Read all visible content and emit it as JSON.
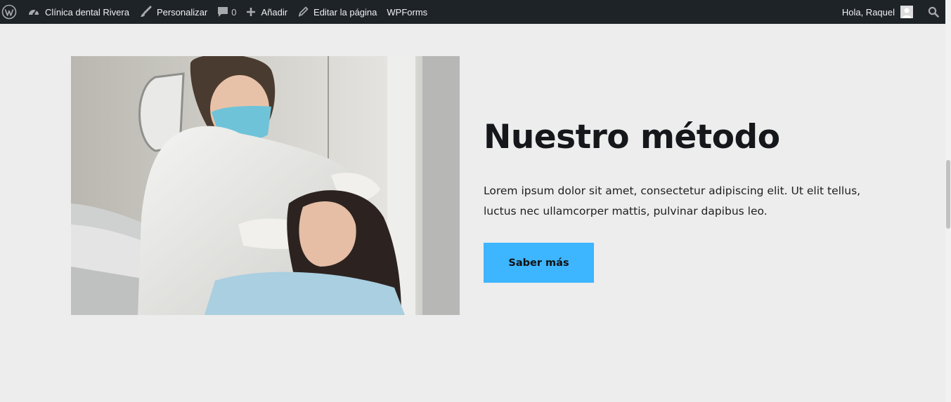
{
  "admin_bar": {
    "site_name": "Clínica dental Rivera",
    "customize_label": "Personalizar",
    "comments_count": "0",
    "add_label": "Añadir",
    "edit_page_label": "Editar la página",
    "wpforms_label": "WPForms",
    "greeting": "Hola, Raquel",
    "icons": [
      "wordpress-logo-icon",
      "dashboard-icon",
      "brush-icon",
      "comment-bubble-icon",
      "plus-icon",
      "pencil-icon",
      "user-avatar-icon",
      "search-icon"
    ]
  },
  "section": {
    "image_alt": "Dentista con mascarilla atendiendo a una paciente",
    "title": "Nuestro método",
    "body": "Lorem ipsum dolor sit amet, consectetur adipiscing elit. Ut elit tellus, luctus nec ullamcorper mattis, pulvinar dapibus leo.",
    "button_label": "Saber más"
  },
  "colors": {
    "admin_bar_bg": "#1d2327",
    "page_bg": "#ededed",
    "accent_button": "#3db5ff",
    "heading": "#15171a"
  }
}
